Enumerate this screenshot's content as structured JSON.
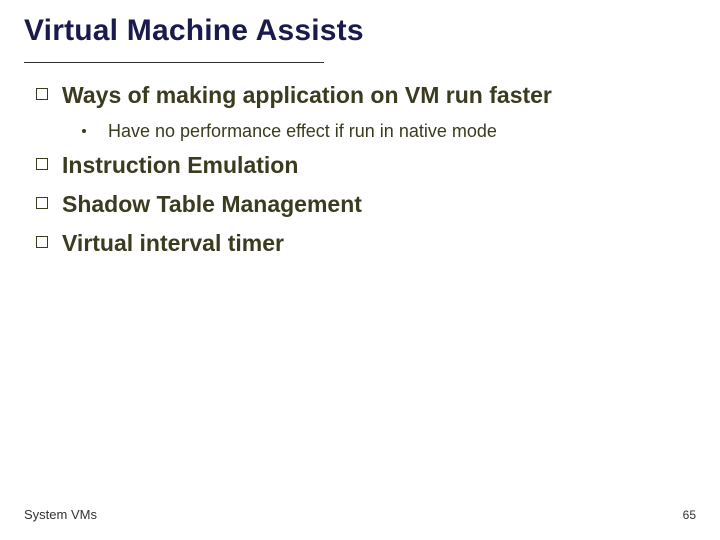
{
  "title": "Virtual Machine Assists",
  "bullets": [
    {
      "text": "Ways of making application on VM run faster",
      "sub": [
        {
          "text": "Have no performance effect if run in native mode"
        }
      ]
    },
    {
      "text": "Instruction Emulation"
    },
    {
      "text": "Shadow Table Management"
    },
    {
      "text": "Virtual interval timer"
    }
  ],
  "footer": {
    "left": "System VMs",
    "right": "65"
  }
}
